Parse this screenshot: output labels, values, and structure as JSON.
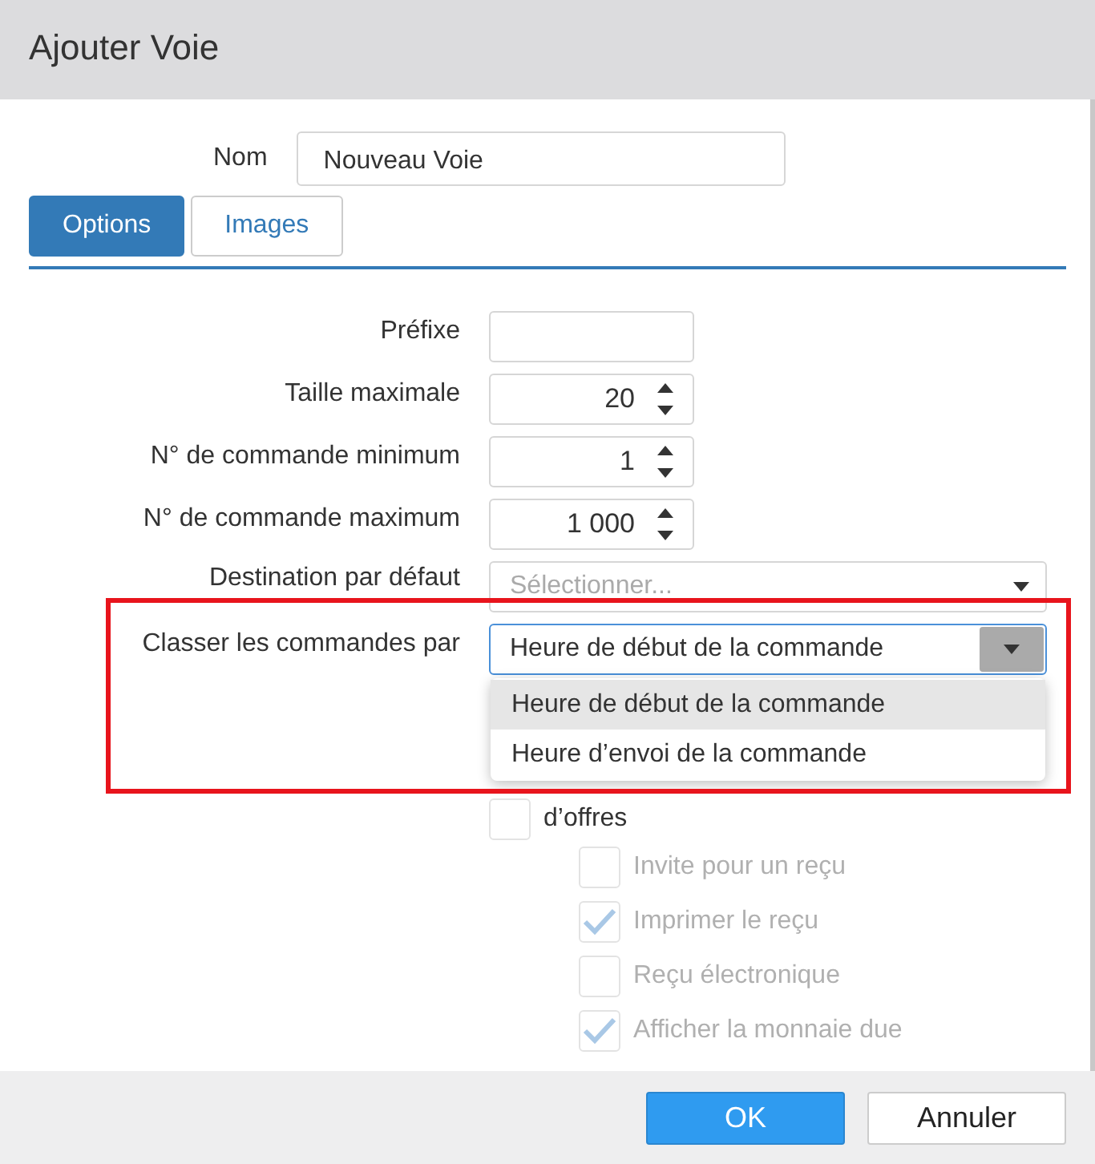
{
  "window": {
    "title": "Ajouter Voie"
  },
  "name_field": {
    "label": "Nom",
    "value": "Nouveau Voie"
  },
  "tabs": [
    {
      "label": "Options",
      "selected": true
    },
    {
      "label": "Images",
      "selected": false
    }
  ],
  "fields": [
    {
      "kind": "text",
      "label": "Préfixe"
    },
    {
      "kind": "number",
      "label": "Taille maximale",
      "value": "20"
    },
    {
      "kind": "number",
      "label": "N° de commande minimum",
      "value": "1"
    },
    {
      "kind": "number",
      "label": "N° de commande maximum",
      "value": "1 000"
    },
    {
      "kind": "select",
      "label": "Destination par défaut",
      "placeholder": "Sélectionner...",
      "expanded": false
    },
    {
      "kind": "select",
      "label": "Classer les commandes par",
      "value": "Heure de début de la commande",
      "expanded": true,
      "options": [
        {
          "label": "Heure de début de la commande",
          "selected": true
        },
        {
          "label": "Heure d’envoi de la commande",
          "selected": false
        }
      ]
    }
  ],
  "checkboxes": [
    {
      "label": "d’offres",
      "checked": false,
      "disabled": false,
      "children": [
        {
          "label": "Invite pour un reçu",
          "checked": false,
          "disabled": true
        },
        {
          "label": "Imprimer le reçu",
          "checked": true,
          "disabled": true
        },
        {
          "label": "Reçu électronique",
          "checked": false,
          "disabled": true
        },
        {
          "label": "Afficher la monnaie due",
          "checked": true,
          "disabled": true
        }
      ]
    }
  ],
  "buttons": [
    {
      "label": "OK",
      "kind": "primary"
    },
    {
      "label": "Annuler",
      "kind": "default"
    }
  ]
}
